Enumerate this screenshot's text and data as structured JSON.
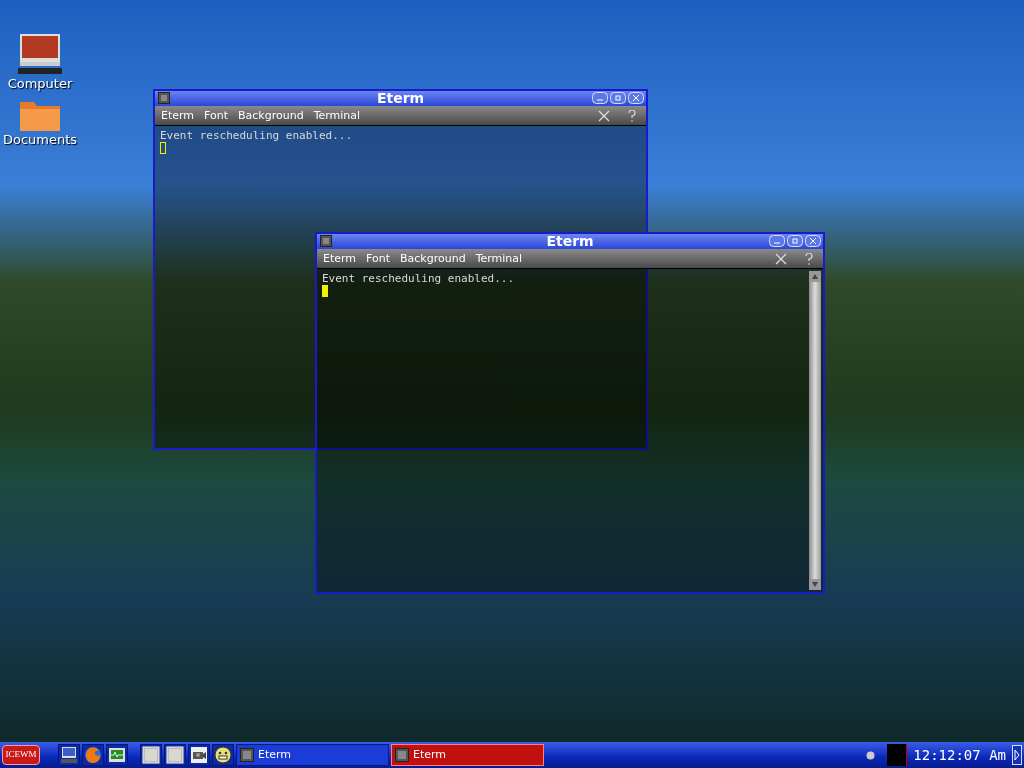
{
  "desktop_icons": [
    {
      "kind": "computer",
      "label": "Computer"
    },
    {
      "kind": "folder",
      "label": "Documents"
    }
  ],
  "windows": [
    {
      "title": "Eterm",
      "focused": false,
      "scrollbar": false,
      "menu": [
        "Eterm",
        "Font",
        "Background",
        "Terminal"
      ],
      "lines": [
        "Event rescheduling enabled..."
      ]
    },
    {
      "title": "Eterm",
      "focused": true,
      "scrollbar": true,
      "menu": [
        "Eterm",
        "Font",
        "Background",
        "Terminal"
      ],
      "lines": [
        "Event rescheduling enabled..."
      ]
    }
  ],
  "taskbar": {
    "start": "ICEWM",
    "launchers": [
      {
        "kind": "computer"
      },
      {
        "kind": "browser"
      },
      {
        "kind": "monitor"
      },
      {
        "kind": "workspace"
      },
      {
        "kind": "workspace"
      },
      {
        "kind": "camera"
      },
      {
        "kind": "face"
      }
    ],
    "tasks": [
      {
        "label": "Eterm",
        "selected": false
      },
      {
        "label": "Eterm",
        "selected": true
      }
    ],
    "clock": "12:12:07 Am"
  }
}
